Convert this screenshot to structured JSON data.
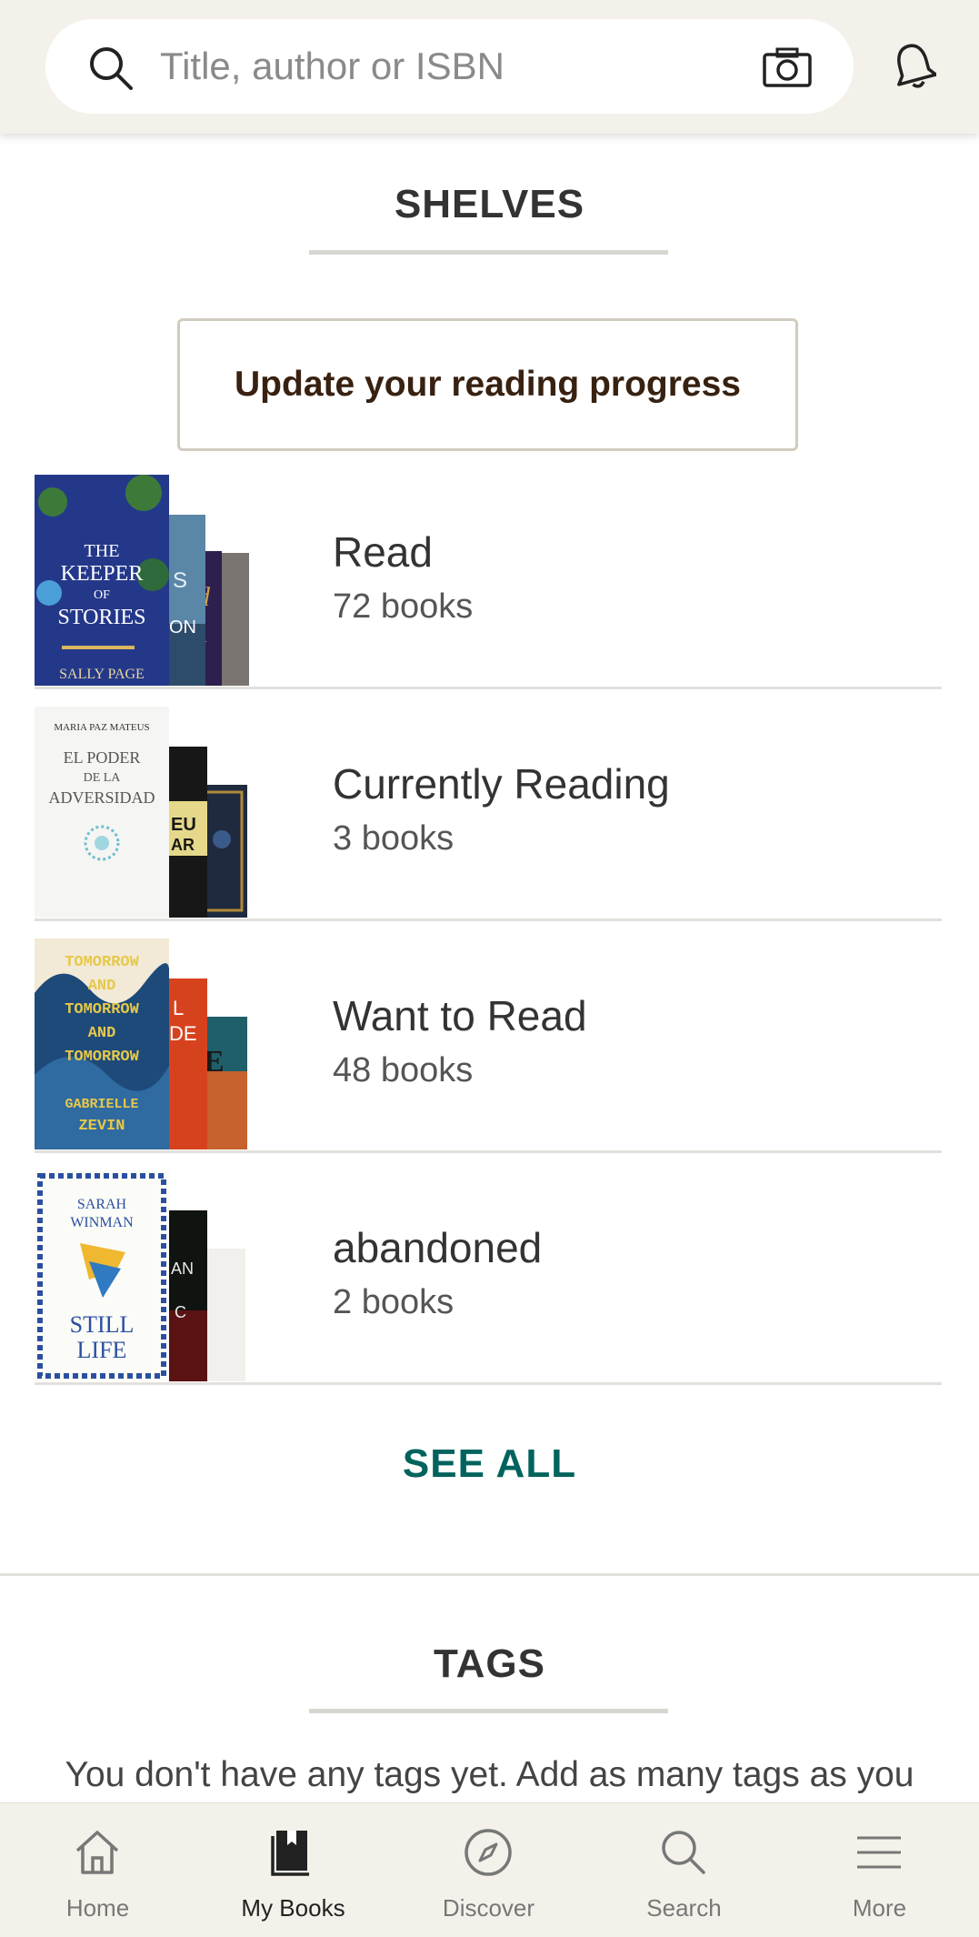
{
  "header": {
    "search_placeholder": "Title, author or ISBN",
    "icons": [
      "search-icon",
      "camera-icon",
      "bell-icon"
    ]
  },
  "shelves_section": {
    "title": "SHELVES",
    "progress_button": "Update your reading progress",
    "shelves": [
      {
        "name": "Read",
        "count": "72 books"
      },
      {
        "name": "Currently Reading",
        "count": "3 books"
      },
      {
        "name": "Want to Read",
        "count": "48 books"
      },
      {
        "name": "abandoned",
        "count": "2 books"
      }
    ],
    "see_all": "SEE ALL"
  },
  "tags_section": {
    "title": "TAGS",
    "empty_text": "You don't have any tags yet. Add as many tags as you"
  },
  "bottom_nav": {
    "items": [
      {
        "label": "Home",
        "icon": "home-icon"
      },
      {
        "label": "My Books",
        "icon": "book-icon"
      },
      {
        "label": "Discover",
        "icon": "compass-icon"
      },
      {
        "label": "Search",
        "icon": "search-icon"
      },
      {
        "label": "More",
        "icon": "menu-icon"
      }
    ],
    "active": "My Books"
  },
  "colors": {
    "header_bg": "#f4f1ea",
    "accent_green": "#00635d",
    "button_text": "#382110"
  }
}
